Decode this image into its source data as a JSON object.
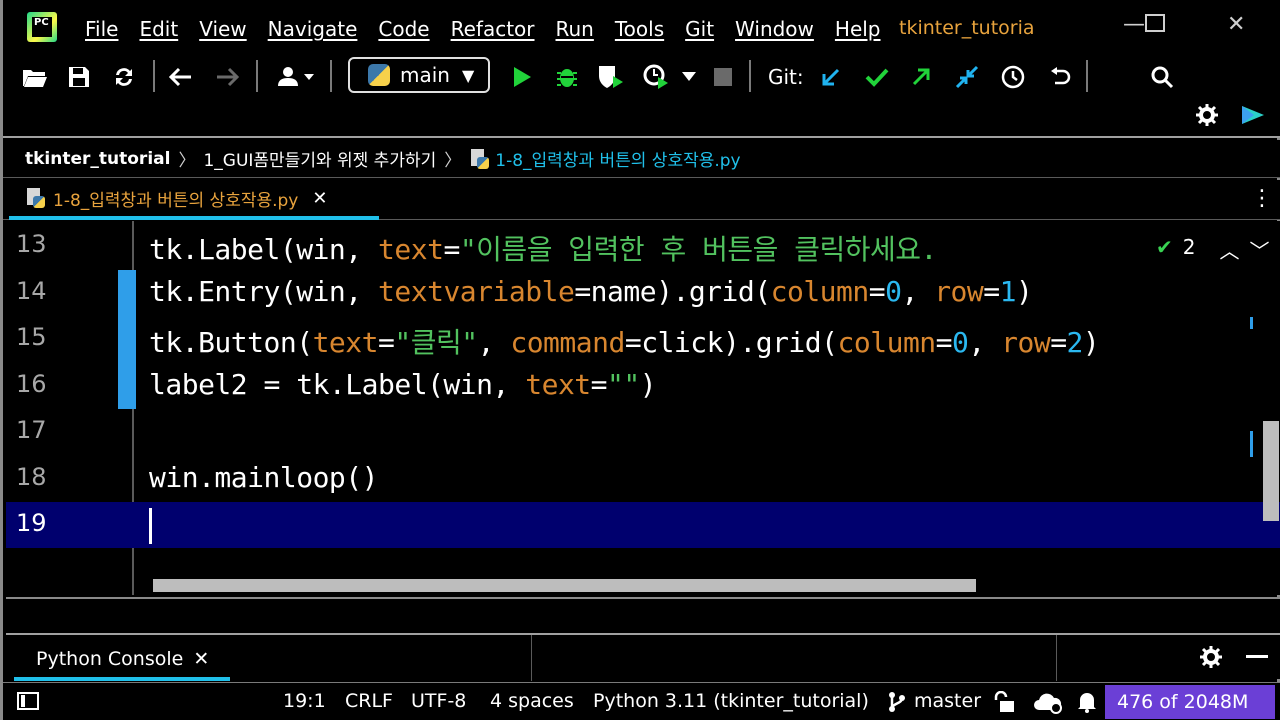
{
  "menu": {
    "items": [
      "File",
      "Edit",
      "View",
      "Navigate",
      "Code",
      "Refactor",
      "Run",
      "Tools",
      "Git",
      "Window",
      "Help"
    ],
    "project_title": "tkinter_tutoria",
    "logo_text": "PC"
  },
  "toolbar": {
    "branch_config": "main",
    "git_label": "Git:",
    "icons": [
      "open-folder",
      "save",
      "sync",
      "back",
      "forward",
      "vcs-user",
      "run",
      "debug",
      "coverage",
      "profile",
      "stop",
      "git-update",
      "git-commit",
      "git-push",
      "git-compare",
      "git-history",
      "git-rollback",
      "search",
      "settings",
      "jetbrains-ai"
    ]
  },
  "breadcrumb": {
    "project": "tkinter_tutorial",
    "folder": "1_GUI폼만들기와 위젯 추가하기",
    "file": "1-8_입력창과 버튼의 상호작용.py"
  },
  "tab": {
    "label": "1-8_입력창과 버튼의 상호작용.py",
    "close": "✕"
  },
  "editor": {
    "lines": [
      {
        "num": "13"
      },
      {
        "num": "14"
      },
      {
        "num": "15"
      },
      {
        "num": "16"
      },
      {
        "num": "17"
      },
      {
        "num": "18"
      },
      {
        "num": "19"
      }
    ],
    "line13": {
      "p1": "tk.Label(win, ",
      "kw1": "text",
      "p2": "=",
      "str1": "\"이름을 입력한 후 버튼을 클릭하세요."
    },
    "line14": {
      "p1": "tk.Entry(win, ",
      "kw1": "textvariable",
      "p2": "=name).grid(",
      "kw2": "column",
      "p3": "=",
      "n1": "0",
      "p4": ", ",
      "kw3": "row",
      "p5": "=",
      "n2": "1",
      "p6": ")"
    },
    "line15": {
      "p1": "tk.Button(",
      "kw1": "text",
      "p2": "=",
      "str1": "\"클릭\"",
      "p3": ", ",
      "kw2": "command",
      "p4": "=click).grid(",
      "kw3": "column",
      "p5": "=",
      "n1": "0",
      "p6": ", ",
      "kw4": "row",
      "p7": "=",
      "n2": "2",
      "p8": ")"
    },
    "line16": {
      "p1": "label2 = tk.Label(win, ",
      "kw1": "text",
      "p2": "=",
      "str1": "\"\"",
      "p3": ")"
    },
    "line18": {
      "p1": "win.mainloop()"
    },
    "inspection": {
      "count": "2",
      "ok": "✔"
    }
  },
  "console": {
    "tab_label": "Python Console",
    "close": "✕"
  },
  "status": {
    "position": "19:1",
    "line_sep": "CRLF",
    "encoding": "UTF-8",
    "indent": "4 spaces",
    "interpreter": "Python 3.11 (tkinter_tutorial)",
    "branch": "master",
    "memory": "476 of 2048M"
  },
  "colors": {
    "accent": "#20c0ea",
    "keyword": "#d8862f",
    "string": "#52c25f",
    "number": "#2bb8f0",
    "current_line": "#00006e",
    "memory_bg": "#6b3fd6"
  }
}
